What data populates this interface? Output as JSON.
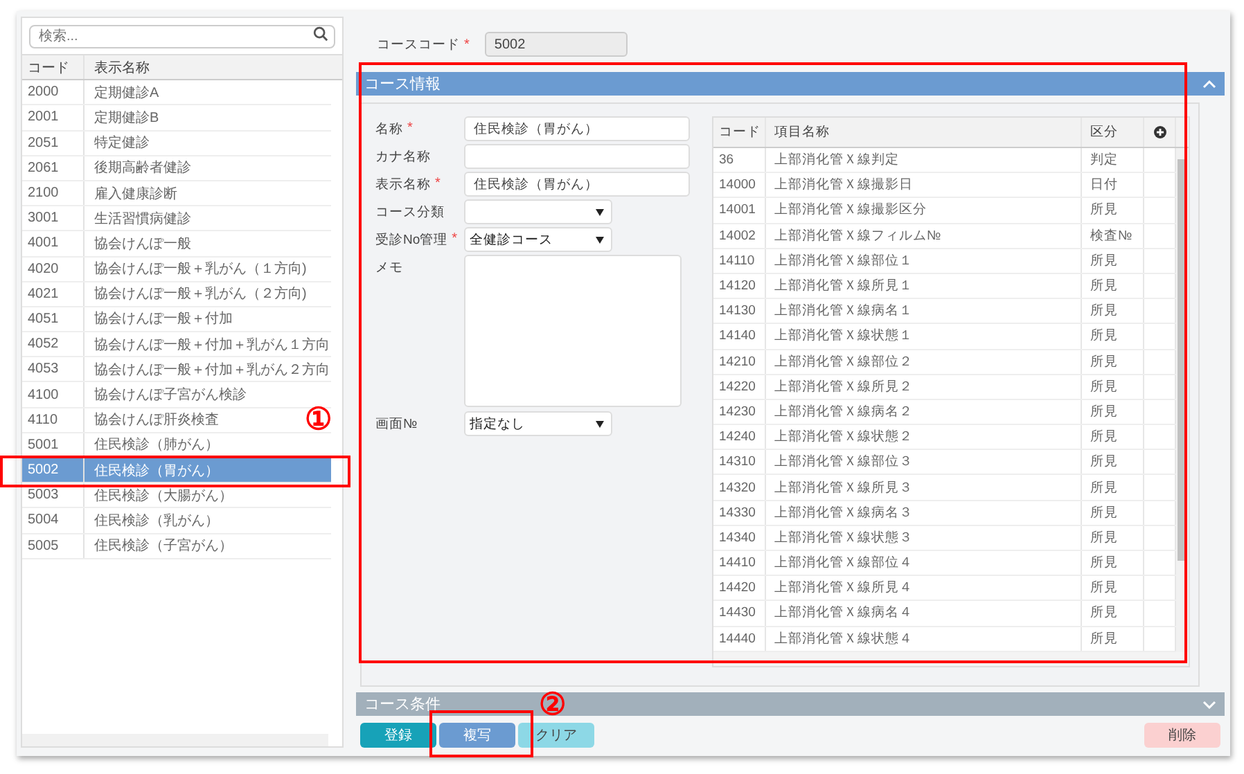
{
  "sidebar": {
    "search": {
      "placeholder": "検索..."
    },
    "columns": [
      "コード",
      "表示名称"
    ],
    "rows": [
      {
        "code": "2000",
        "name": "定期健診A",
        "selected": false
      },
      {
        "code": "2001",
        "name": "定期健診B",
        "selected": false
      },
      {
        "code": "2051",
        "name": "特定健診",
        "selected": false
      },
      {
        "code": "2061",
        "name": "後期高齢者健診",
        "selected": false
      },
      {
        "code": "2100",
        "name": "雇入健康診断",
        "selected": false
      },
      {
        "code": "3001",
        "name": "生活習慣病健診",
        "selected": false
      },
      {
        "code": "4001",
        "name": "協会けんぽ一般",
        "selected": false
      },
      {
        "code": "4020",
        "name": "協会けんぽ一般＋乳がん（１方向)",
        "selected": false
      },
      {
        "code": "4021",
        "name": "協会けんぽ一般＋乳がん（２方向)",
        "selected": false
      },
      {
        "code": "4051",
        "name": "協会けんぽ一般＋付加",
        "selected": false
      },
      {
        "code": "4052",
        "name": "協会けんぽ一般＋付加＋乳がん１方向",
        "selected": false
      },
      {
        "code": "4053",
        "name": "協会けんぽ一般＋付加＋乳がん２方向",
        "selected": false
      },
      {
        "code": "4100",
        "name": "協会けんぽ子宮がん検診",
        "selected": false
      },
      {
        "code": "4110",
        "name": "協会けんぽ肝炎検査",
        "selected": false
      },
      {
        "code": "5001",
        "name": "住民検診（肺がん）",
        "selected": false
      },
      {
        "code": "5002",
        "name": "住民検診（胃がん）",
        "selected": true
      },
      {
        "code": "5003",
        "name": "住民検診（大腸がん）",
        "selected": false
      },
      {
        "code": "5004",
        "name": "住民検診（乳がん）",
        "selected": false
      },
      {
        "code": "5005",
        "name": "住民検診（子宮がん）",
        "selected": false
      }
    ]
  },
  "course_code": {
    "label": "コースコード",
    "marker": "*",
    "value": "5002"
  },
  "course_info": {
    "title": "コース情報",
    "expanded": true,
    "fields": [
      {
        "kind": "text",
        "label": "名称",
        "marker": "*",
        "value": "住民検診（胃がん）"
      },
      {
        "kind": "text",
        "label": "カナ名称"
      },
      {
        "kind": "text",
        "label": "表示名称",
        "marker": "*",
        "value": "住民検診（胃がん）"
      },
      {
        "kind": "select",
        "label": "コース分類"
      },
      {
        "kind": "select",
        "label": "受診No管理",
        "marker": "*",
        "value": "全健診コース"
      },
      {
        "kind": "memo",
        "label": "メモ"
      },
      {
        "kind": "select",
        "label": "画面№",
        "value": "指定なし"
      }
    ],
    "items_table": {
      "columns": [
        "コード",
        "項目名称",
        "区分"
      ],
      "rows": [
        [
          "36",
          "上部消化管Ｘ線判定",
          "判定"
        ],
        [
          "14000",
          "上部消化管Ｘ線撮影日",
          "日付"
        ],
        [
          "14001",
          "上部消化管Ｘ線撮影区分",
          "所見"
        ],
        [
          "14002",
          "上部消化管Ｘ線フィルム№",
          "検査№"
        ],
        [
          "14110",
          "上部消化管Ｘ線部位１",
          "所見"
        ],
        [
          "14120",
          "上部消化管Ｘ線所見１",
          "所見"
        ],
        [
          "14130",
          "上部消化管Ｘ線病名１",
          "所見"
        ],
        [
          "14140",
          "上部消化管Ｘ線状態１",
          "所見"
        ],
        [
          "14210",
          "上部消化管Ｘ線部位２",
          "所見"
        ],
        [
          "14220",
          "上部消化管Ｘ線所見２",
          "所見"
        ],
        [
          "14230",
          "上部消化管Ｘ線病名２",
          "所見"
        ],
        [
          "14240",
          "上部消化管Ｘ線状態２",
          "所見"
        ],
        [
          "14310",
          "上部消化管Ｘ線部位３",
          "所見"
        ],
        [
          "14320",
          "上部消化管Ｘ線所見３",
          "所見"
        ],
        [
          "14330",
          "上部消化管Ｘ線病名３",
          "所見"
        ],
        [
          "14340",
          "上部消化管Ｘ線状態３",
          "所見"
        ],
        [
          "14410",
          "上部消化管Ｘ線部位４",
          "所見"
        ],
        [
          "14420",
          "上部消化管Ｘ線所見４",
          "所見"
        ],
        [
          "14430",
          "上部消化管Ｘ線病名４",
          "所見"
        ],
        [
          "14440",
          "上部消化管Ｘ線状態４",
          "所見"
        ]
      ]
    }
  },
  "course_conditions": {
    "title": "コース条件",
    "expanded": false
  },
  "buttons": [
    {
      "label": "登録",
      "kind": "teal",
      "disabled": false
    },
    {
      "label": "複写",
      "kind": "blue",
      "disabled": false
    },
    {
      "label": "クリア",
      "kind": "teal",
      "disabled": true
    },
    {
      "label": "削除",
      "kind": "red",
      "disabled": true
    }
  ],
  "annotations": [
    {
      "label": "①"
    },
    {
      "label": "②"
    }
  ]
}
